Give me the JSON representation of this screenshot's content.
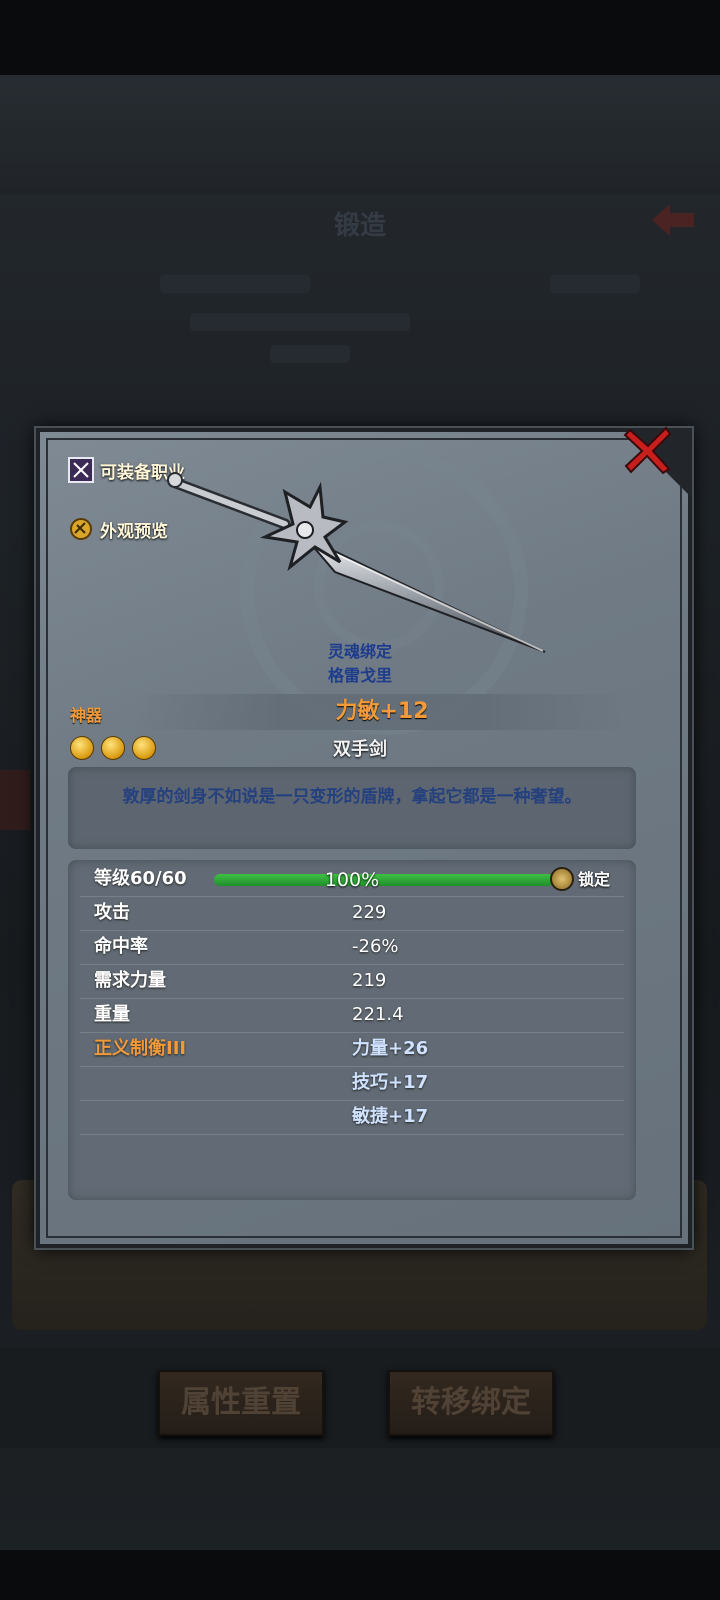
{
  "background": {
    "title": "锻造",
    "buttons": {
      "reset_label": "属性重置",
      "transfer_label": "转移绑定"
    }
  },
  "modal": {
    "left_links": {
      "job_label": "可装备职业",
      "preview_label": "外观预览"
    },
    "bind_status": "灵魂绑定",
    "item_name": "格雷戈里",
    "tier": "神器",
    "main_stat": "力敏+12",
    "weapon_type": "双手剑",
    "star_count": 3,
    "description": "敦厚的剑身不如说是一只变形的盾牌，拿起它都是一种奢望。",
    "level": {
      "label": "等级60/60",
      "percent_text": "100%",
      "progress": 1.0,
      "lock_label": "锁定"
    },
    "stats": [
      {
        "label": "攻击",
        "value": "229"
      },
      {
        "label": "命中率",
        "value": "-26%"
      },
      {
        "label": "需求力量",
        "value": "219"
      },
      {
        "label": "重量",
        "value": "221.4"
      }
    ],
    "bonus": {
      "label": "正义制衡III",
      "values": [
        "力量+26",
        "技巧+17",
        "敏捷+17"
      ]
    }
  },
  "colors": {
    "accent_orange": "#f29a38",
    "bind_blue": "#1e3c8c",
    "bar_green": "#3fbf44",
    "close_red": "#c81e1e"
  }
}
